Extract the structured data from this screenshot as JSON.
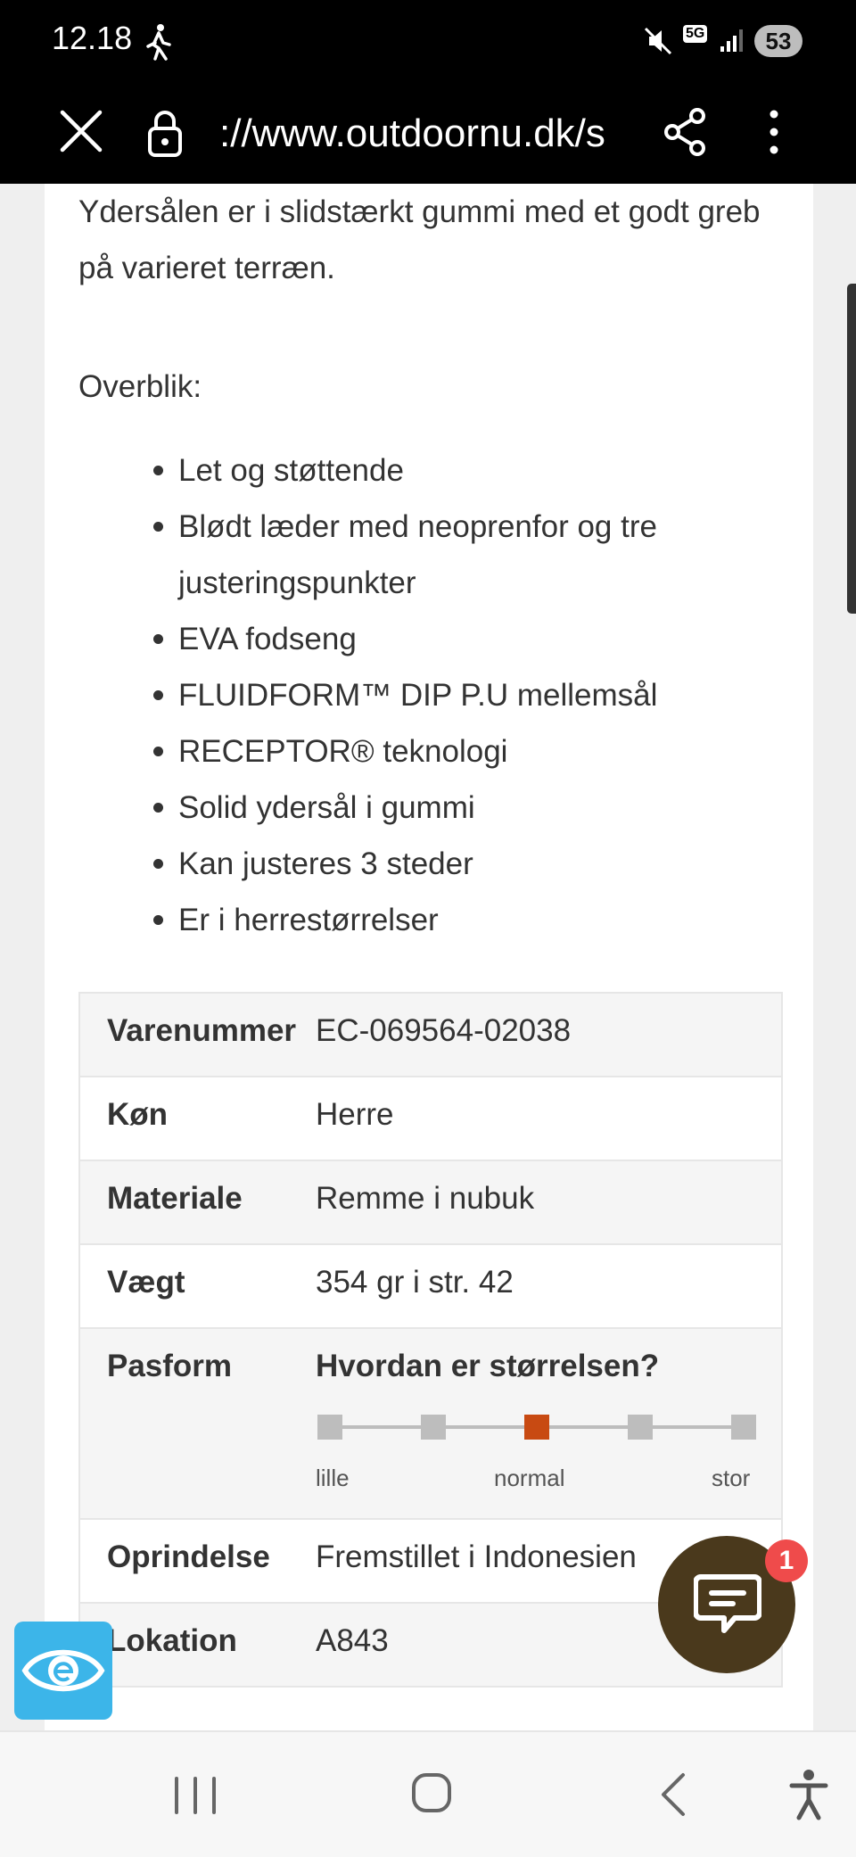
{
  "status_bar": {
    "time": "12.18",
    "network": "5G",
    "battery": "53",
    "icons": [
      "walking-icon",
      "mute-icon",
      "signal-icon",
      "battery-icon"
    ]
  },
  "browser": {
    "url": "://www.outdoornu.dk/s",
    "icons": [
      "close-icon",
      "lock-icon",
      "share-icon",
      "more-menu-icon"
    ]
  },
  "product": {
    "intro": "Ydersålen er i slidstærkt gummi med et godt greb på varieret terræn.",
    "overview_label": "Overblik:",
    "features": [
      "Let og støttende",
      "Blødt læder med neoprenfor og tre justeringspunkter",
      "EVA fodseng",
      "FLUIDFORM™ DIP P.U mellemsål",
      "RECEPTOR® teknologi",
      "Solid ydersål i gummi",
      "Kan justeres 3 steder",
      "Er i herrestørrelser"
    ]
  },
  "specs": {
    "varenummer": {
      "label": "Varenummer",
      "value": "EC-069564-02038"
    },
    "kon": {
      "label": "Køn",
      "value": "Herre"
    },
    "materiale": {
      "label": "Materiale",
      "value": "Remme i nubuk"
    },
    "vaegt": {
      "label": "Vægt",
      "value": "354 gr i str. 42"
    },
    "pasform": {
      "label": "Pasform",
      "question": "Hvordan er størrelsen?",
      "scale_points": 5,
      "selected_index": 2,
      "low_label": "lille",
      "mid_label": "normal",
      "high_label": "stor"
    },
    "oprindelse": {
      "label": "Oprindelse",
      "value": "Fremstillet i Indonesien"
    },
    "lokation": {
      "label": "Lokation",
      "value": "A843"
    }
  },
  "chat": {
    "badge_count": "1",
    "icon": "chat-icon"
  },
  "accessibility": {
    "icon": "eye-accessibility-icon"
  },
  "nav": {
    "icons": [
      "recent-apps-icon",
      "home-icon",
      "back-icon",
      "accessibility-icon"
    ]
  },
  "colors": {
    "accent": "#c84a12",
    "chat_bg": "#4a391c",
    "badge": "#ef4b4b",
    "access_bg": "#3cb5e9"
  }
}
